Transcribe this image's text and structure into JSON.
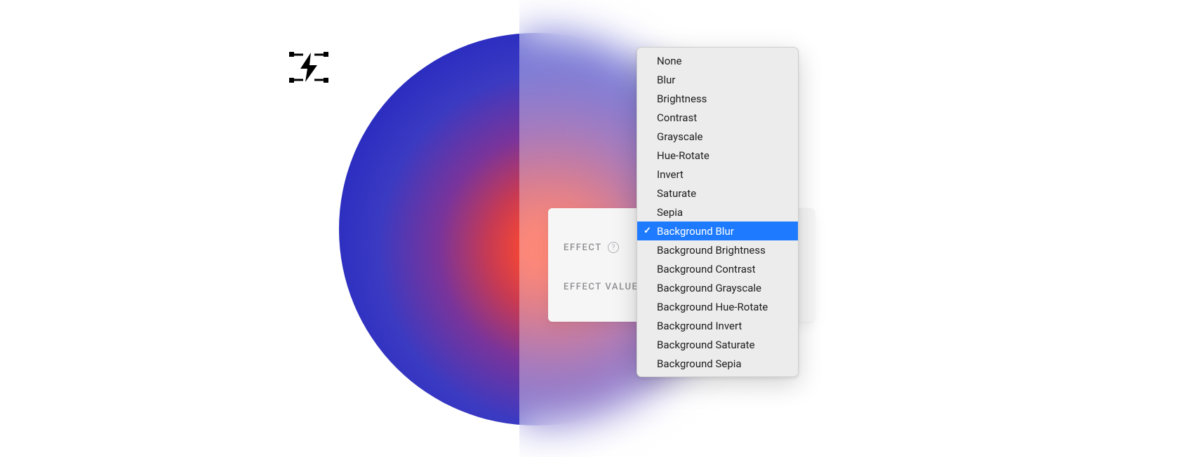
{
  "panel": {
    "effect_label": "EFFECT",
    "effect_value_label": "EFFECT VALUE",
    "help_glyph": "?"
  },
  "menu": {
    "selected_index": 9,
    "check_glyph": "✓",
    "items": [
      "None",
      "Blur",
      "Brightness",
      "Contrast",
      "Grayscale",
      "Hue-Rotate",
      "Invert",
      "Saturate",
      "Sepia",
      "Background Blur",
      "Background Brightness",
      "Background Contrast",
      "Background Grayscale",
      "Background Hue-Rotate",
      "Background Invert",
      "Background Saturate",
      "Background Sepia"
    ]
  }
}
